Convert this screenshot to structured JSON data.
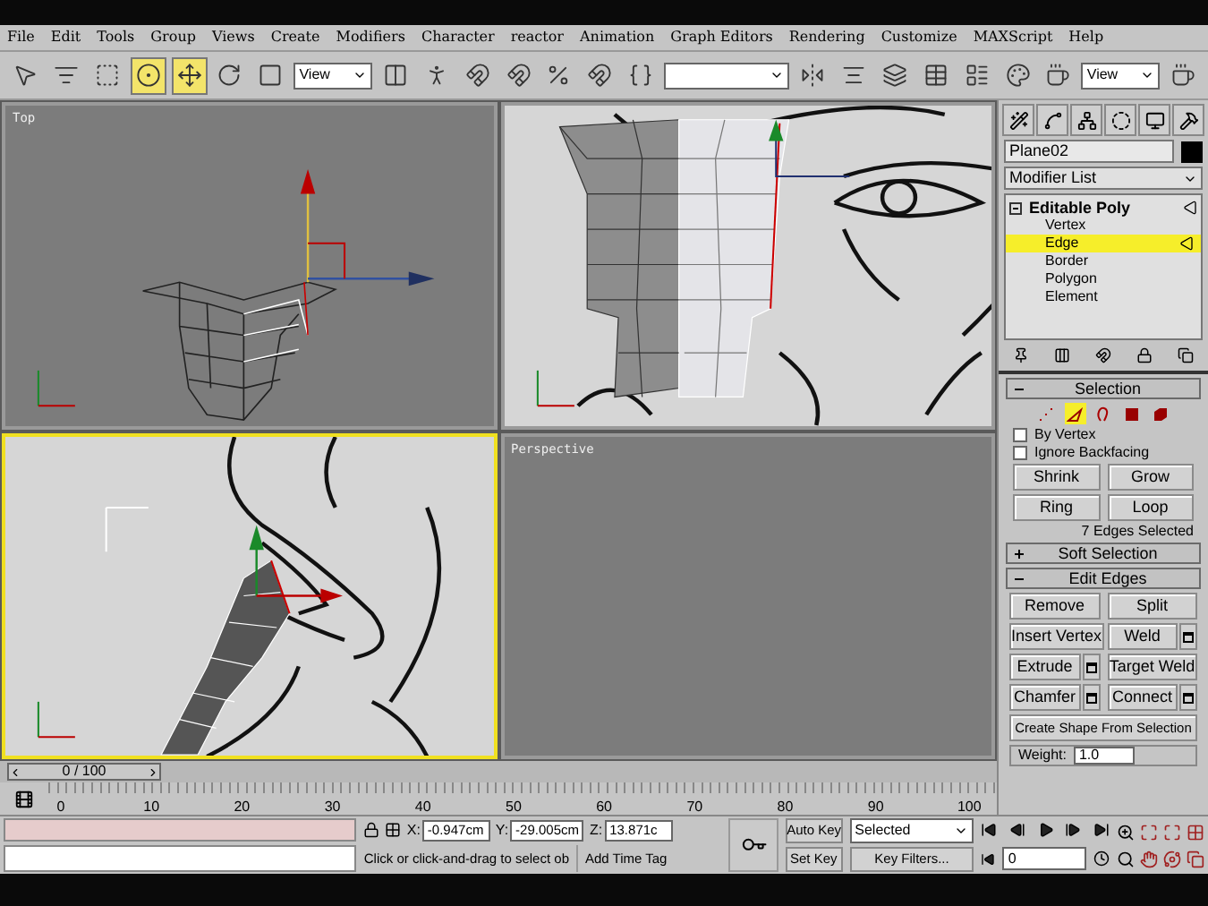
{
  "menu": [
    "File",
    "Edit",
    "Tools",
    "Group",
    "Views",
    "Create",
    "Modifiers",
    "Character",
    "reactor",
    "Animation",
    "Graph Editors",
    "Rendering",
    "Customize",
    "MAXScript",
    "Help"
  ],
  "toolbar": [
    {
      "kind": "tool",
      "selected": false
    },
    {
      "kind": "tool",
      "selected": false
    },
    {
      "kind": "tool",
      "selected": false
    },
    {
      "kind": "tool",
      "selected": true
    },
    {
      "kind": "tool",
      "selected": true
    },
    {
      "kind": "tool",
      "selected": false
    },
    {
      "kind": "tool",
      "selected": false
    },
    {
      "kind": "dropdown",
      "value": "View"
    },
    {
      "kind": "tool",
      "selected": false
    },
    {
      "kind": "tool",
      "selected": false
    },
    {
      "kind": "tool",
      "selected": false
    },
    {
      "kind": "tool",
      "selected": false
    },
    {
      "kind": "tool",
      "selected": false
    },
    {
      "kind": "tool",
      "selected": false
    },
    {
      "kind": "tool",
      "selected": false
    },
    {
      "kind": "dropdown"
    },
    {
      "kind": "tool",
      "selected": false
    },
    {
      "kind": "tool",
      "selected": false
    },
    {
      "kind": "tool",
      "selected": false
    },
    {
      "kind": "tool",
      "selected": false
    },
    {
      "kind": "tool",
      "selected": false
    },
    {
      "kind": "tool",
      "selected": false
    },
    {
      "kind": "tool",
      "selected": false
    },
    {
      "kind": "dropdown",
      "value": "View"
    },
    {
      "kind": "tool",
      "selected": false
    }
  ],
  "viewports": [
    {
      "kind": "top",
      "label": "Top",
      "active": false
    },
    {
      "kind": "front",
      "active": false
    },
    {
      "kind": "left",
      "active": true
    },
    {
      "kind": "perspective",
      "label": "Perspective",
      "active": false
    }
  ],
  "command_panel": {
    "object_name": "Plane02",
    "modifier_list": "Modifier List",
    "stack": [
      {
        "label": "Editable Poly",
        "expanded": true,
        "children": [
          {
            "label": "Vertex",
            "selected": false
          },
          {
            "label": "Edge",
            "selected": true
          },
          {
            "label": "Border",
            "selected": false
          },
          {
            "label": "Polygon",
            "selected": false
          },
          {
            "label": "Element",
            "selected": false
          }
        ]
      }
    ],
    "rollouts": [
      {
        "kind": "selection",
        "title": "Selection",
        "expanded": true,
        "levels": [
          {
            "selected": false
          },
          {
            "selected": true
          },
          {
            "selected": false
          },
          {
            "selected": false
          },
          {
            "selected": false
          }
        ],
        "checkboxes": [
          {
            "label": "By Vertex",
            "checked": false
          },
          {
            "label": "Ignore Backfacing",
            "checked": false
          }
        ],
        "buttons": [
          "Shrink",
          "Grow",
          "Ring",
          "Loop"
        ],
        "status": "7 Edges Selected"
      },
      {
        "kind": "soft_selection",
        "title": "Soft Selection",
        "expanded": false
      },
      {
        "kind": "edit_edges",
        "title": "Edit Edges",
        "expanded": true,
        "buttons": [
          {
            "label": "Remove",
            "settings": false
          },
          {
            "label": "Split",
            "settings": false
          },
          {
            "label": "Insert Vertex",
            "settings": false
          },
          {
            "label": "Weld",
            "settings": true
          },
          {
            "label": "Extrude",
            "settings": true
          },
          {
            "label": "Target Weld",
            "settings": false
          },
          {
            "label": "Chamfer",
            "settings": true
          },
          {
            "label": "Connect",
            "settings": true
          }
        ],
        "wide_button": "Create Shape From Selection",
        "weight": {
          "label": "Weight:",
          "value": "1.0"
        }
      }
    ]
  },
  "time_slider": {
    "label": "0 / 100",
    "level": 0
  },
  "track_bar": {
    "ticks": [
      "0",
      "10",
      "20",
      "30",
      "40",
      "50",
      "60",
      "70",
      "80",
      "90",
      "100"
    ]
  },
  "status_bar": {
    "x_label": "X:",
    "x": "-0.947cm",
    "y_label": "Y:",
    "y": "-29.005cm",
    "z_label": "Z:",
    "z": "13.871c",
    "prompt": "Click or click-and-drag to select ob",
    "time_tag": "Add Time Tag",
    "auto_key": "Auto Key",
    "set_key": "Set Key",
    "key_mode": "Selected",
    "key_filters": "Key Filters...",
    "frame": "0"
  }
}
